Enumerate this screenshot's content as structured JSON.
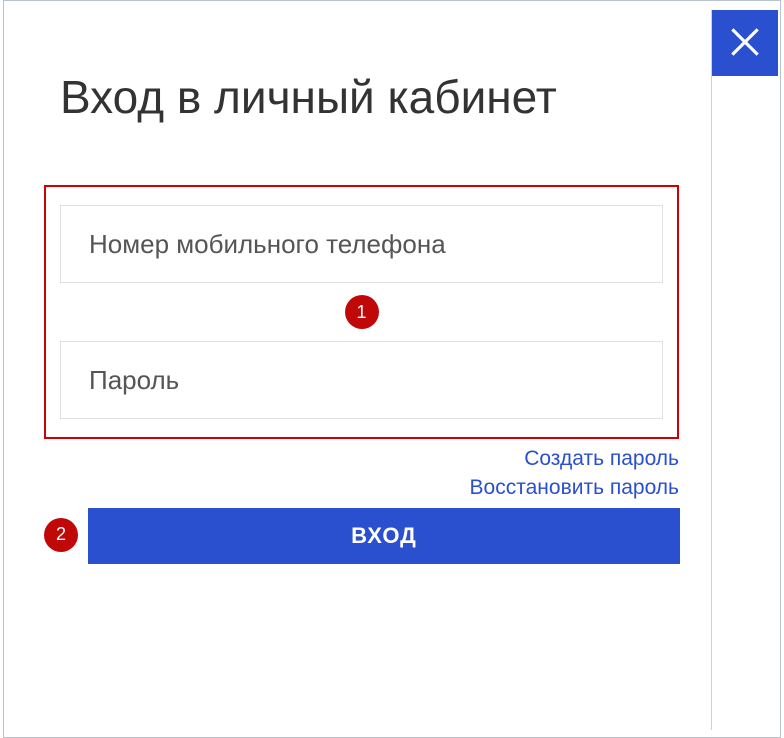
{
  "modal": {
    "title": "Вход в личный кабинет",
    "phone_placeholder": "Номер мобильного телефона",
    "password_placeholder": "Пароль",
    "create_password_label": "Создать пароль",
    "restore_password_label": "Восстановить пароль",
    "login_button_label": "ВХОД"
  },
  "annotations": {
    "badge1": "1",
    "badge2": "2"
  }
}
